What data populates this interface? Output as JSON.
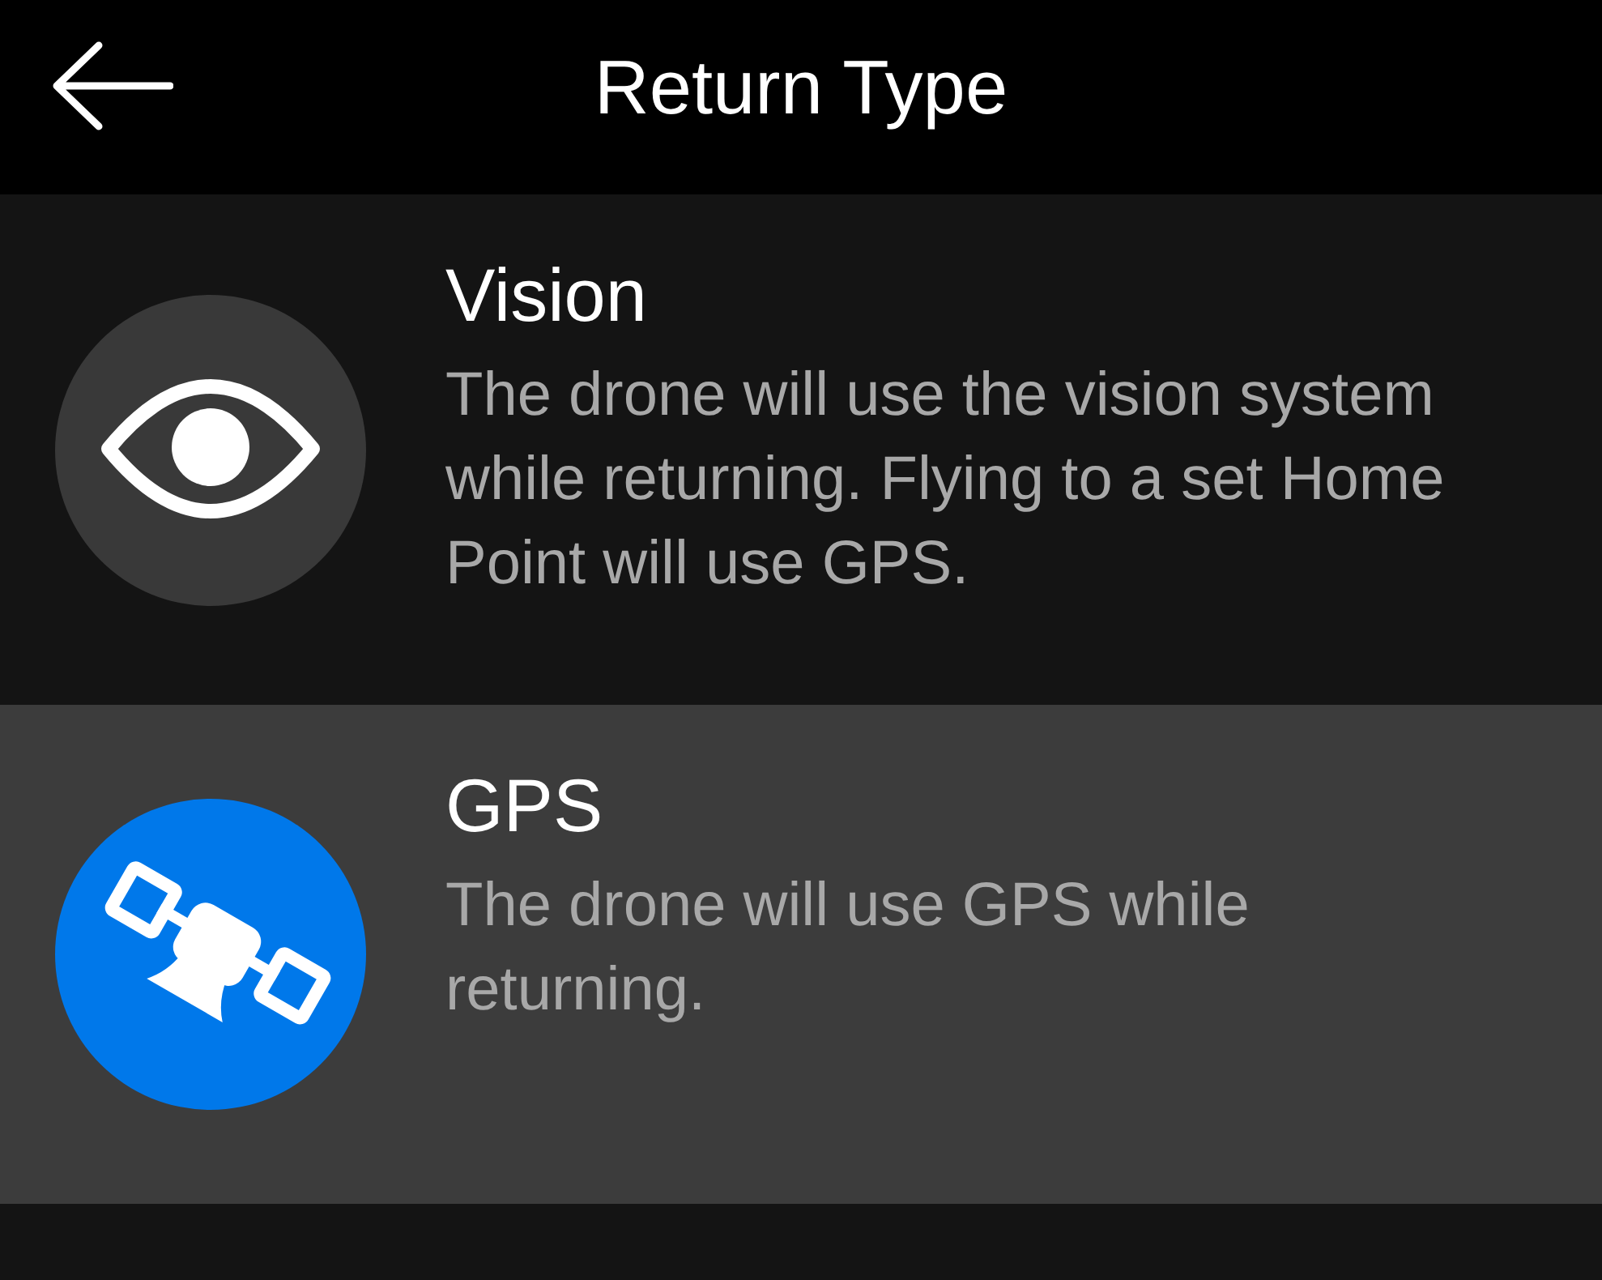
{
  "header": {
    "title": "Return Type"
  },
  "options": [
    {
      "title": "Vision",
      "description": "The drone will use the vision system while returning. Flying to a set Home Point will use GPS.",
      "selected": false
    },
    {
      "title": "GPS",
      "description": "The drone will use GPS while returning.",
      "selected": true
    }
  ]
}
